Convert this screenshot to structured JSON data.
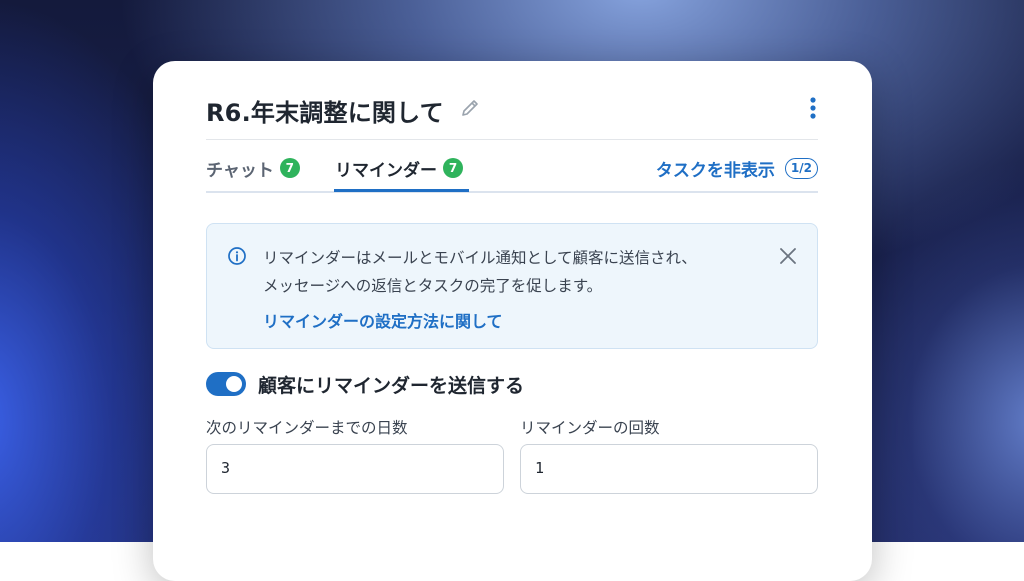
{
  "header": {
    "title": "R6.年末調整に関して"
  },
  "tabs": [
    {
      "label": "チャット",
      "badge": "7",
      "active": false
    },
    {
      "label": "リマインダー",
      "badge": "7",
      "active": true
    }
  ],
  "task_toggle": {
    "label": "タスクを非表示",
    "count": "1/2"
  },
  "info": {
    "line1": "リマインダーはメールとモバイル通知として顧客に送信され、",
    "line2": "メッセージへの返信とタスクの完了を促します。",
    "link": "リマインダーの設定方法に関して"
  },
  "reminder_toggle": {
    "label": "顧客にリマインダーを送信する",
    "enabled": true
  },
  "fields": [
    {
      "label": "次のリマインダーまでの日数",
      "value": "3"
    },
    {
      "label": "リマインダーの回数",
      "value": "1"
    }
  ],
  "colors": {
    "accent": "#1f6fc5",
    "badge": "#2fb35c",
    "info_bg": "#eef6fc"
  }
}
